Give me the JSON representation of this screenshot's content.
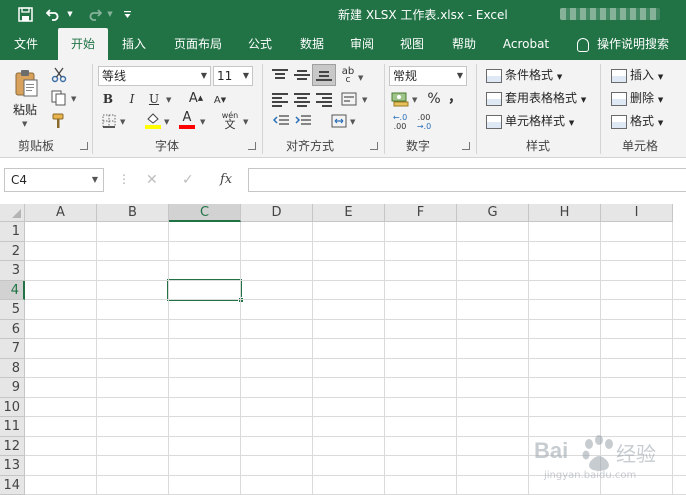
{
  "window": {
    "title": "新建 XLSX 工作表.xlsx  -  Excel",
    "accent_color": "#217346"
  },
  "quick_access": {
    "save_icon": "save-icon",
    "undo_icon": "undo-icon",
    "redo_icon": "redo-icon",
    "customize_icon": "customize-quick-access-icon"
  },
  "tabs": [
    {
      "label": "文件"
    },
    {
      "label": "开始"
    },
    {
      "label": "插入"
    },
    {
      "label": "页面布局"
    },
    {
      "label": "公式"
    },
    {
      "label": "数据"
    },
    {
      "label": "审阅"
    },
    {
      "label": "视图"
    },
    {
      "label": "帮助"
    },
    {
      "label": "Acrobat"
    }
  ],
  "active_tab": "开始",
  "tell_me": "操作说明搜索",
  "ribbon": {
    "clipboard": {
      "label": "剪贴板",
      "paste": "粘贴"
    },
    "font": {
      "label": "字体",
      "font_name": "等线",
      "font_size": "11",
      "bold": "B",
      "italic": "I",
      "underline": "U",
      "grow": "A",
      "shrink": "A",
      "font_color_letter": "A",
      "phonetic_top": "wén",
      "phonetic_bottom": "文",
      "fill_color": "#ffff00",
      "font_color": "#ff0000"
    },
    "alignment": {
      "label": "对齐方式",
      "wrap_glyph": "ab",
      "wrap_glyph2": "c"
    },
    "number": {
      "label": "数字",
      "format": "常规",
      "percent": "%",
      "comma": "，",
      "inc_decimal_top": "←.0",
      "inc_decimal_bottom": ".00",
      "dec_decimal_top": ".00",
      "dec_decimal_bottom": "→.0"
    },
    "styles": {
      "label": "样式",
      "conditional": "条件格式",
      "table": "套用表格格式",
      "cell_styles": "单元格样式"
    },
    "cells": {
      "label": "单元格",
      "insert": "插入",
      "delete": "删除",
      "format": "格式"
    }
  },
  "formula_bar": {
    "name_box": "C4",
    "cancel": "✕",
    "enter": "✓",
    "fx": "fx",
    "value": ""
  },
  "sheet": {
    "columns": [
      "A",
      "B",
      "C",
      "D",
      "E",
      "F",
      "G",
      "H",
      "I"
    ],
    "rows": [
      "1",
      "2",
      "3",
      "4",
      "5",
      "6",
      "7",
      "8",
      "9",
      "10",
      "11",
      "12",
      "13",
      "14"
    ],
    "selected_column": "C",
    "selected_row": "4",
    "active_cell": "C4"
  },
  "watermark": {
    "brand_left": "Bai",
    "brand_right": "经验",
    "url": "jingyan.baidu.com"
  }
}
